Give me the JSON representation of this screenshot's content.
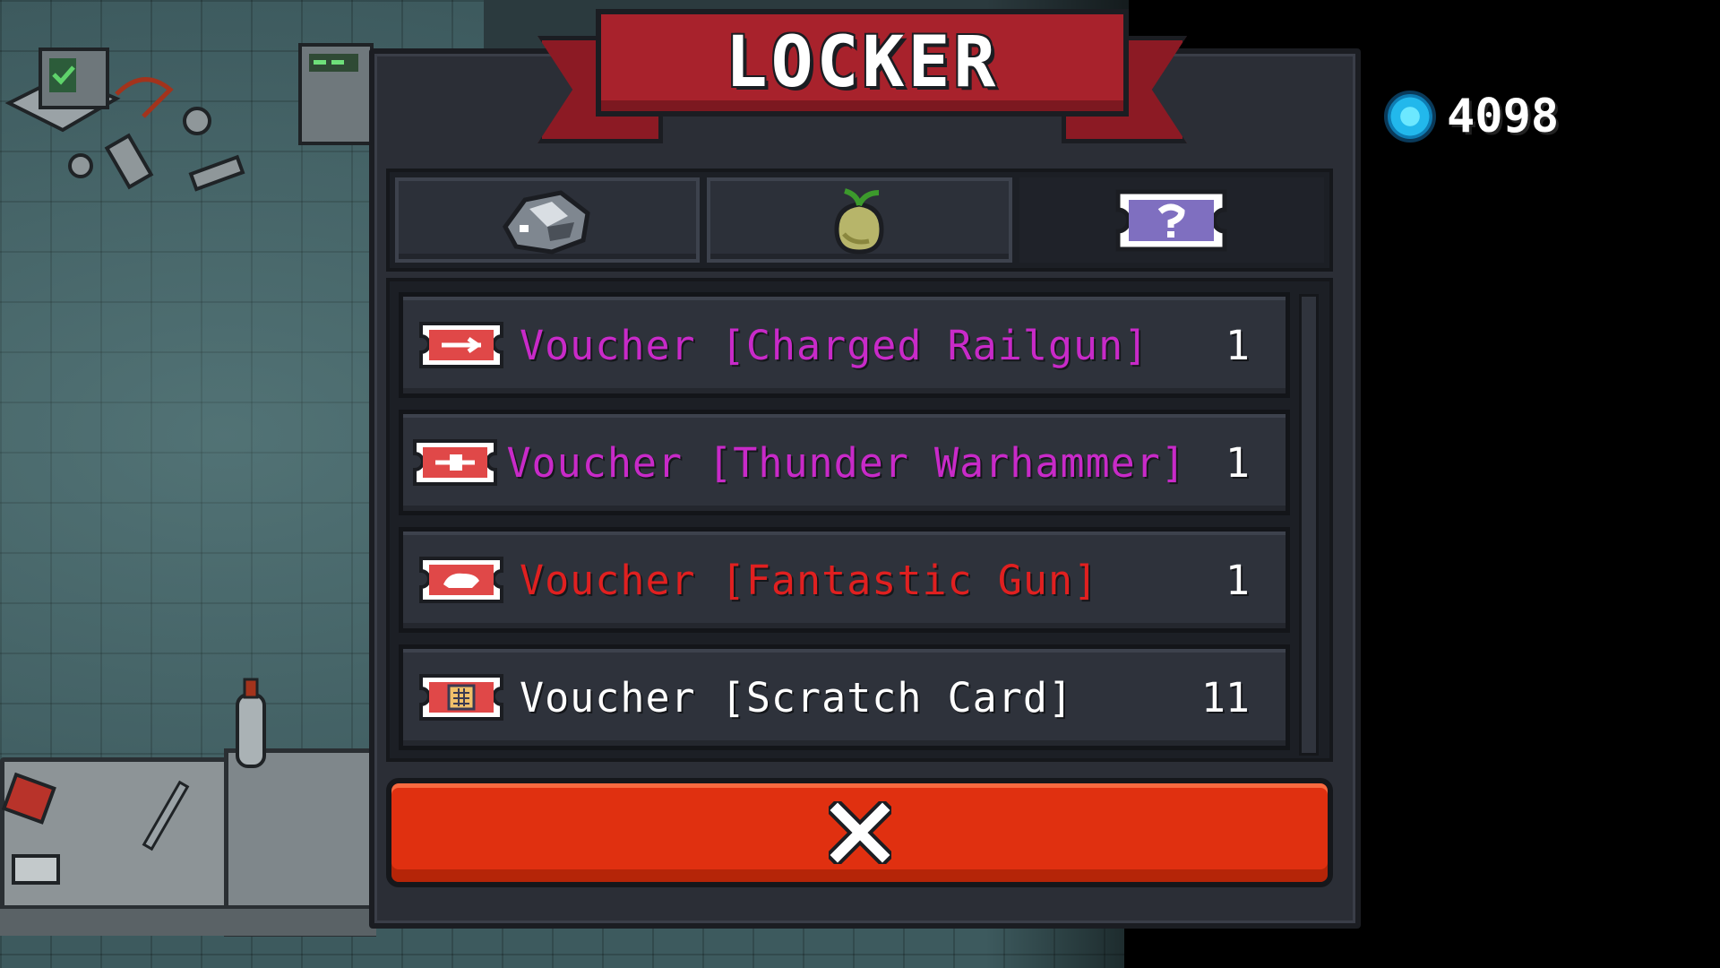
{
  "title": "LOCKER",
  "currency": {
    "icon": "blue-gem-icon",
    "value": "4098"
  },
  "tabs": [
    {
      "icon": "ore-icon",
      "active": false
    },
    {
      "icon": "seed-pouch-icon",
      "active": false
    },
    {
      "icon": "voucher-ticket-icon",
      "active": true
    }
  ],
  "items": [
    {
      "icon": "voucher-ticket-icon",
      "name": "Voucher [Charged Railgun]",
      "count": "1",
      "color": "#c82ac8"
    },
    {
      "icon": "voucher-ticket-icon",
      "name": "Voucher [Thunder Warhammer]",
      "count": "1",
      "color": "#c82ac8"
    },
    {
      "icon": "voucher-ticket-icon",
      "name": "Voucher [Fantastic Gun]",
      "count": "1",
      "color": "#e02020"
    },
    {
      "icon": "voucher-ticket-icon",
      "name": "Voucher [Scratch Card]",
      "count": "11",
      "color": "#ffffff"
    }
  ],
  "close_button": {
    "icon": "close-icon"
  },
  "colors": {
    "banner": "#a8222c",
    "close": "#e03010",
    "panel": "#2b2e36",
    "gem": "#22b8ec"
  }
}
